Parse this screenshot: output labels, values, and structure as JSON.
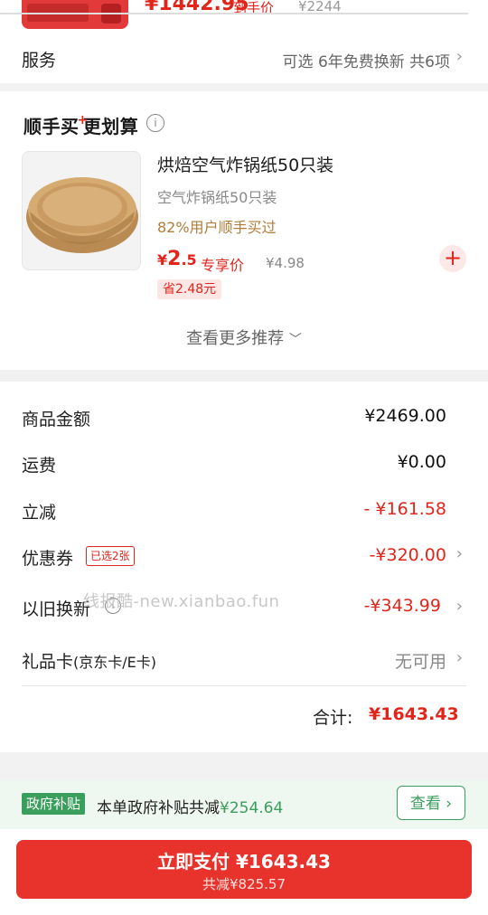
{
  "top": {
    "price": "¥1442.95",
    "daoshou": "到手价",
    "old_price": "¥2244",
    "service_label": "服务",
    "service_value": "可选 6年免费换新 共6项"
  },
  "recommend": {
    "title_part1": "顺手买",
    "title_plus": "+",
    "title_part2": "更划算",
    "product": {
      "name": "烘焙空气炸锅纸50只装",
      "subtitle": "空气炸锅纸50只装",
      "promo": "82%用户顺手买过",
      "price_yen": "¥",
      "price_int": "2",
      "price_dec": ".5",
      "exclusive": "专享价",
      "old_price": "¥4.98",
      "save": "省2.48元"
    },
    "more": "查看更多推荐"
  },
  "summary": {
    "rows": [
      {
        "label": "商品金额",
        "value": "¥2469.00"
      },
      {
        "label": "运费",
        "value": "¥0.00"
      },
      {
        "label": "立减",
        "value": "- ¥161.58"
      },
      {
        "label": "优惠券",
        "value": "-¥320.00",
        "tag": "已选2张"
      },
      {
        "label": "以旧换新",
        "value": "-¥343.99"
      },
      {
        "label": "礼品卡",
        "label_small": "(京东卡/E卡)",
        "value": "无可用"
      }
    ],
    "total_label": "合计:",
    "total_value": "¥1643.43"
  },
  "watermark": "线报酷-new.xianbao.fun",
  "subsidy": {
    "badge": "政府补贴",
    "text": "本单政府补贴共减",
    "amount": "¥254.64",
    "view": "查看"
  },
  "pay": {
    "label": "立即支付 ¥1643.43",
    "sub": "共减¥825.57"
  },
  "colors": {
    "brand_red": "#e1251b",
    "gov_green": "#3a9e5c"
  }
}
